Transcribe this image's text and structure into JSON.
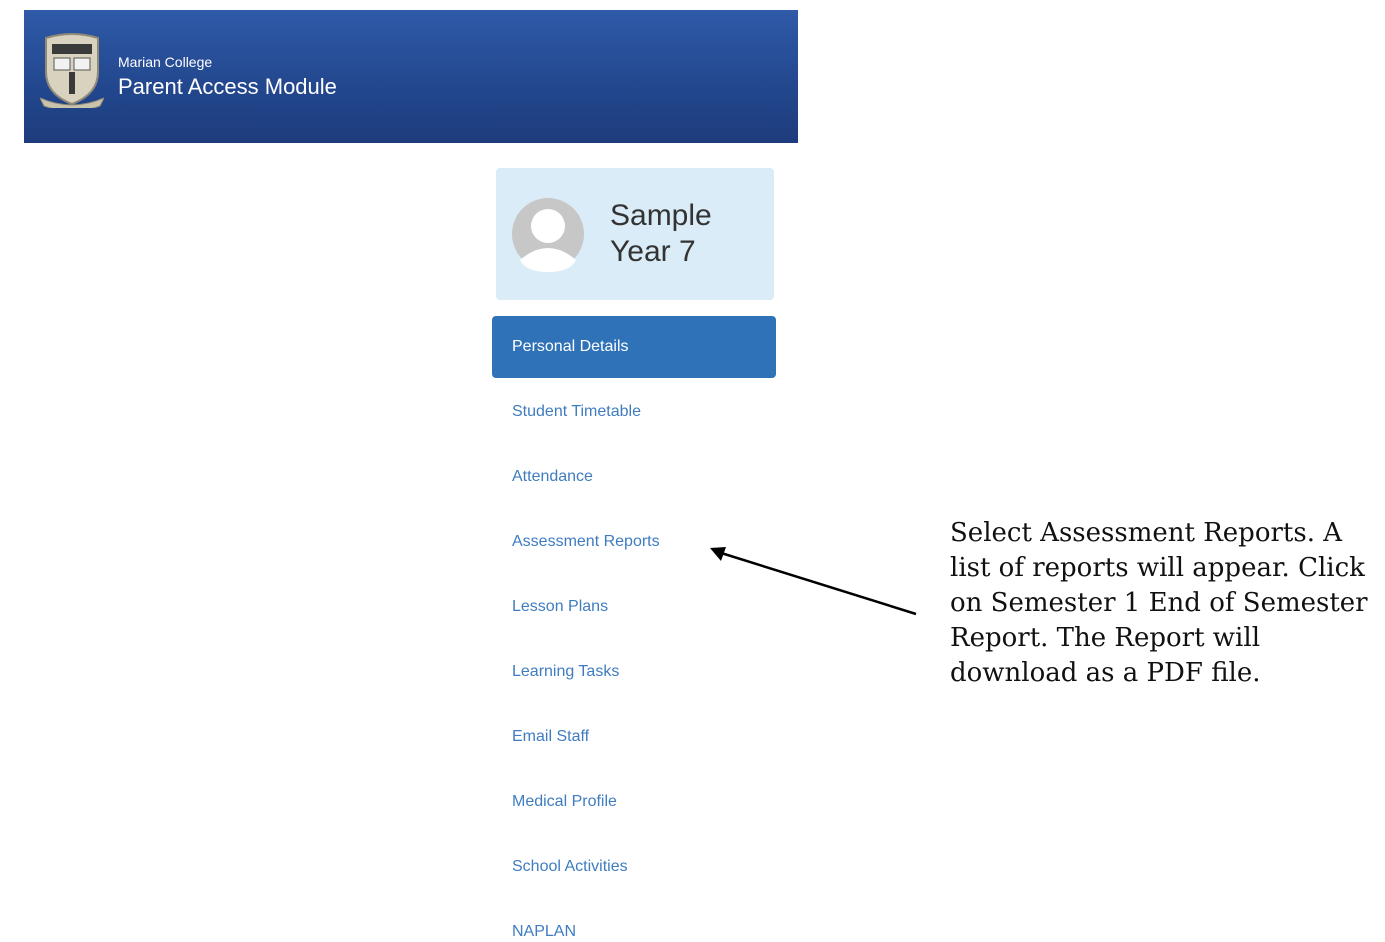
{
  "header": {
    "college_name": "Marian College",
    "module_name": "Parent Access Module"
  },
  "student": {
    "name_line1": "Sample",
    "name_line2": "Year 7"
  },
  "nav": {
    "items": [
      {
        "label": "Personal Details",
        "active": true
      },
      {
        "label": "Student Timetable",
        "active": false
      },
      {
        "label": "Attendance",
        "active": false
      },
      {
        "label": "Assessment Reports",
        "active": false
      },
      {
        "label": "Lesson Plans",
        "active": false
      },
      {
        "label": "Learning Tasks",
        "active": false
      },
      {
        "label": "Email Staff",
        "active": false
      },
      {
        "label": "Medical Profile",
        "active": false
      },
      {
        "label": "School Activities",
        "active": false
      },
      {
        "label": "NAPLAN",
        "active": false
      }
    ]
  },
  "annotation": {
    "text": "Select Assessment Reports. A list of reports will appear.  Click on Semester 1 End of Semester Report.  The Report will download as a PDF file."
  },
  "colors": {
    "header_blue": "#23488f",
    "active_nav": "#2f72b8",
    "nav_link": "#3f7cc0",
    "card_background": "#d9ecf7"
  }
}
